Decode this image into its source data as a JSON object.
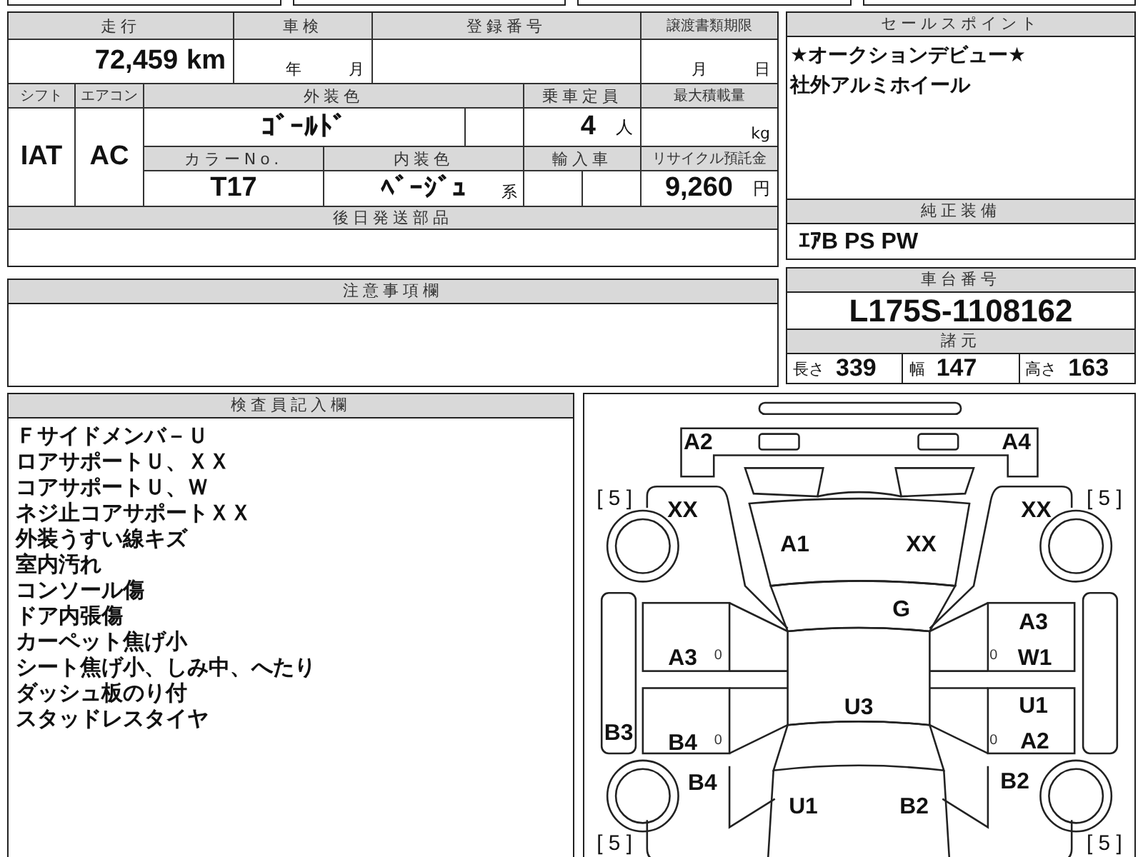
{
  "info_table": {
    "cells": [
      {
        "kind": "header",
        "text": "走行"
      },
      {
        "kind": "header",
        "text": "車検"
      },
      {
        "kind": "header",
        "text": "登録番号"
      },
      {
        "kind": "header",
        "text": "譲渡書類期限"
      },
      {
        "kind": "value",
        "text": "72,459",
        "unit": "km"
      },
      {
        "kind": "note",
        "text": "年　　　月"
      },
      {
        "kind": "blank"
      },
      {
        "kind": "note",
        "text": "月　　　日"
      },
      {
        "kind": "header",
        "text": "シフト"
      },
      {
        "kind": "header",
        "text": "エアコン"
      },
      {
        "kind": "header",
        "text": "外装色"
      },
      {
        "kind": "header",
        "text": "乗車定員"
      },
      {
        "kind": "header",
        "text": "最大積載量"
      },
      {
        "kind": "value",
        "text": "IAT"
      },
      {
        "kind": "value",
        "text": "AC"
      },
      {
        "kind": "value",
        "text": "ｺﾞｰﾙﾄﾞ"
      },
      {
        "kind": "blank"
      },
      {
        "kind": "value",
        "text": "4",
        "unit": "人"
      },
      {
        "kind": "note",
        "text": "kg"
      },
      {
        "kind": "header",
        "text": "カラーNo."
      },
      {
        "kind": "header",
        "text": "内装色"
      },
      {
        "kind": "header",
        "text": "輸入車"
      },
      {
        "kind": "header",
        "text": "リサイクル預託金"
      },
      {
        "kind": "value",
        "text": "T17"
      },
      {
        "kind": "value",
        "text": "ﾍﾞｰｼﾞｭ",
        "suffix": "系"
      },
      {
        "kind": "blank"
      },
      {
        "kind": "blank"
      },
      {
        "kind": "value",
        "text": "9,260",
        "unit": "円"
      },
      {
        "kind": "header",
        "text": "後日発送部品"
      },
      {
        "kind": "blank"
      }
    ]
  },
  "sales_points": {
    "title": "セールスポイント",
    "lines": [
      "★オークションデビュー★",
      "社外アルミホイール"
    ]
  },
  "equipment": {
    "title": "純正装備",
    "value": "ｴｱB PS PW"
  },
  "notes": {
    "title": "注意事項欄"
  },
  "chassis": {
    "title": "車台番号",
    "value": "L175S-1108162"
  },
  "specs": {
    "title": "諸元",
    "items": [
      {
        "label": "長さ",
        "value": "339"
      },
      {
        "label": "幅",
        "value": "147"
      },
      {
        "label": "高さ",
        "value": "163"
      }
    ]
  },
  "inspector": {
    "title": "検査員記入欄",
    "lines": [
      "Ｆサイドメンバ－Ｕ",
      "ロアサポートＵ、ＸＸ",
      "コアサポートＵ、Ｗ",
      "ネジ止コアサポートＸＸ",
      "外装うすい線キズ",
      "室内汚れ",
      "コンソール傷",
      "ドア内張傷",
      "カーペット焦げ小",
      "シート焦げ小、しみ中、へたり",
      "ダッシュ板のり付",
      "スタッドレスタイヤ"
    ]
  },
  "diagram": {
    "labels": [
      {
        "kind": "code",
        "text": "A2"
      },
      {
        "kind": "code",
        "text": "A4"
      },
      {
        "kind": "rating",
        "text": "[ 5 ]"
      },
      {
        "kind": "rating",
        "text": "[ 5 ]"
      },
      {
        "kind": "code",
        "text": "XX"
      },
      {
        "kind": "code",
        "text": "XX"
      },
      {
        "kind": "code",
        "text": "A1"
      },
      {
        "kind": "code",
        "text": "XX"
      },
      {
        "kind": "code",
        "text": "G"
      },
      {
        "kind": "code",
        "text": "A3"
      },
      {
        "kind": "code",
        "text": "A3"
      },
      {
        "kind": "mark",
        "text": "0"
      },
      {
        "kind": "mark",
        "text": "0"
      },
      {
        "kind": "code",
        "text": "W1"
      },
      {
        "kind": "code",
        "text": "U1"
      },
      {
        "kind": "code",
        "text": "U3"
      },
      {
        "kind": "code",
        "text": "B3"
      },
      {
        "kind": "code",
        "text": "B4"
      },
      {
        "kind": "mark",
        "text": "0"
      },
      {
        "kind": "mark",
        "text": "0"
      },
      {
        "kind": "code",
        "text": "A2"
      },
      {
        "kind": "code",
        "text": "B2"
      },
      {
        "kind": "code",
        "text": "B4"
      },
      {
        "kind": "code",
        "text": "U1"
      },
      {
        "kind": "code",
        "text": "B2"
      },
      {
        "kind": "rating",
        "text": "[ 5 ]"
      },
      {
        "kind": "rating",
        "text": "[ 5 ]"
      }
    ]
  }
}
